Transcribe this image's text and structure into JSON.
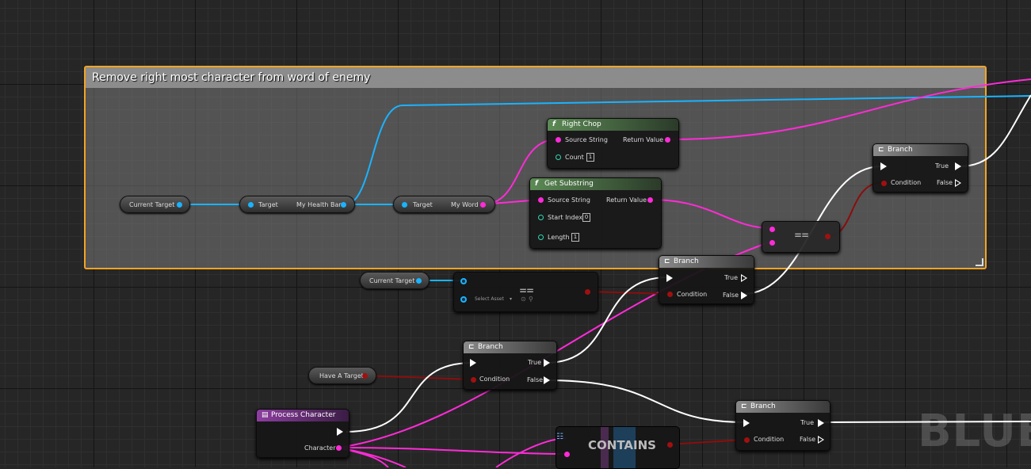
{
  "comment": {
    "title": "Remove right most character from word of enemy"
  },
  "vars": {
    "current_target_1": "Current Target",
    "current_target_2": "Current Target",
    "have_a_target": "Have A Target"
  },
  "getters": {
    "health_bar": {
      "target": "Target",
      "output": "My Health Bar"
    },
    "my_word": {
      "target": "Target",
      "output": "My Word"
    }
  },
  "right_chop": {
    "title": "Right Chop",
    "source": "Source String",
    "return": "Return Value",
    "count_label": "Count",
    "count_value": "1"
  },
  "get_substring": {
    "title": "Get Substring",
    "source": "Source String",
    "return": "Return Value",
    "start_label": "Start Index",
    "start_value": "0",
    "length_label": "Length",
    "length_value": "1"
  },
  "equals": {
    "glyph": "=="
  },
  "select_asset": {
    "placeholder": "Select Asset",
    "glyph": "=="
  },
  "branch": {
    "title": "Branch",
    "true_label": "True",
    "false_label": "False",
    "condition_label": "Condition"
  },
  "process_character": {
    "title": "Process Character",
    "param": "Character"
  },
  "contains": {
    "label": "CONTAINS"
  },
  "watermark": "BLUEI",
  "colors": {
    "comment_border": "#f4a423",
    "string_pin": "#ff2bd8",
    "object_pin": "#1ab3ff",
    "bool_pin": "#a01010",
    "exec": "#ffffff"
  }
}
